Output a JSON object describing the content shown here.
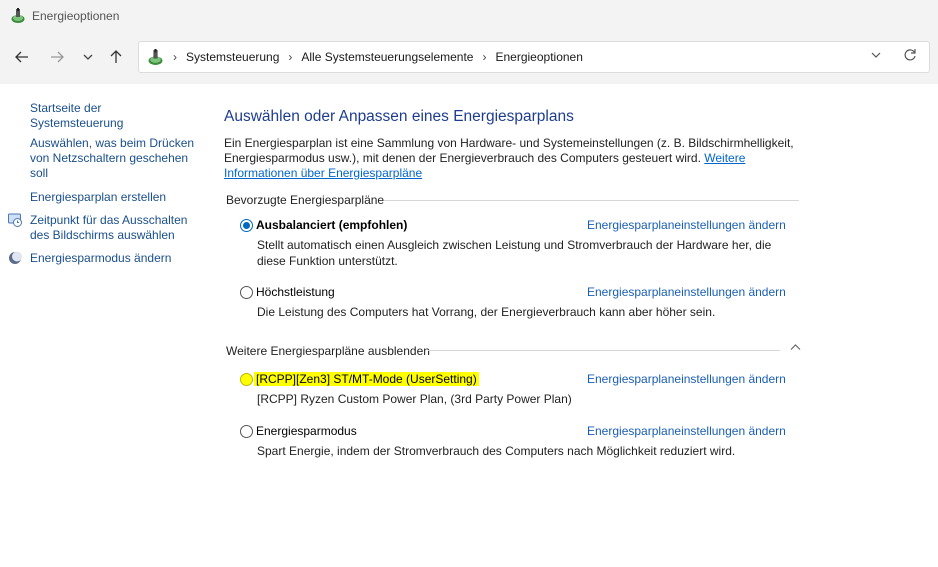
{
  "window": {
    "title": "Energieoptionen"
  },
  "address": {
    "crumbs": [
      "Systemsteuerung",
      "Alle Systemsteuerungselemente",
      "Energieoptionen"
    ]
  },
  "sidebar": {
    "items": [
      {
        "label": "Startseite der Systemsteuerung"
      },
      {
        "label": "Auswählen, was beim Drücken von Netzschaltern geschehen soll"
      },
      {
        "label": "Energiesparplan erstellen"
      },
      {
        "label": "Zeitpunkt für das Ausschalten des Bildschirms auswählen"
      },
      {
        "label": "Energiesparmodus ändern"
      }
    ]
  },
  "main": {
    "heading": "Auswählen oder Anpassen eines Energiesparplans",
    "intro": "Ein Energiesparplan ist eine Sammlung von Hardware- und Systemeinstellungen (z. B. Bildschirmhelligkeit, Energiesparmodus usw.), mit denen der Energieverbrauch des Computers gesteuert wird.",
    "intro_link": "Weitere Informationen über Energiesparpläne",
    "preferred_title": "Bevorzugte Energiesparpläne",
    "more_title": "Weitere Energiesparpläne ausblenden",
    "change_link": "Energiesparplaneinstellungen ändern",
    "plans": [
      {
        "name": "Ausbalanciert (empfohlen)",
        "desc": "Stellt automatisch einen Ausgleich zwischen Leistung und Stromverbrauch der Hardware her, die diese Funktion unterstützt.",
        "selected": true
      },
      {
        "name": "Höchstleistung",
        "desc": "Die Leistung des Computers hat Vorrang, der Energieverbrauch kann aber höher sein.",
        "selected": false
      },
      {
        "name": "[RCPP][Zen3] ST/MT-Mode (UserSetting)",
        "desc": "[RCPP] Ryzen Custom Power Plan, (3rd Party Power Plan)",
        "selected": false,
        "highlighted": true
      },
      {
        "name": "Energiesparmodus",
        "desc": "Spart Energie, indem der Stromverbrauch des Computers nach Möglichkeit reduziert wird.",
        "selected": false
      }
    ]
  },
  "colors": {
    "link": "#1a5fb4",
    "heading": "#1e3d8f",
    "highlight": "#ffff00",
    "radio_checked": "#0067c0"
  },
  "icons": [
    "power-options-icon",
    "back-arrow-icon",
    "forward-arrow-icon",
    "recent-chevron-icon",
    "up-arrow-icon",
    "chevron-down-icon",
    "refresh-icon",
    "monitor-clock-icon",
    "moon-icon",
    "collapse-chevron-icon"
  ]
}
